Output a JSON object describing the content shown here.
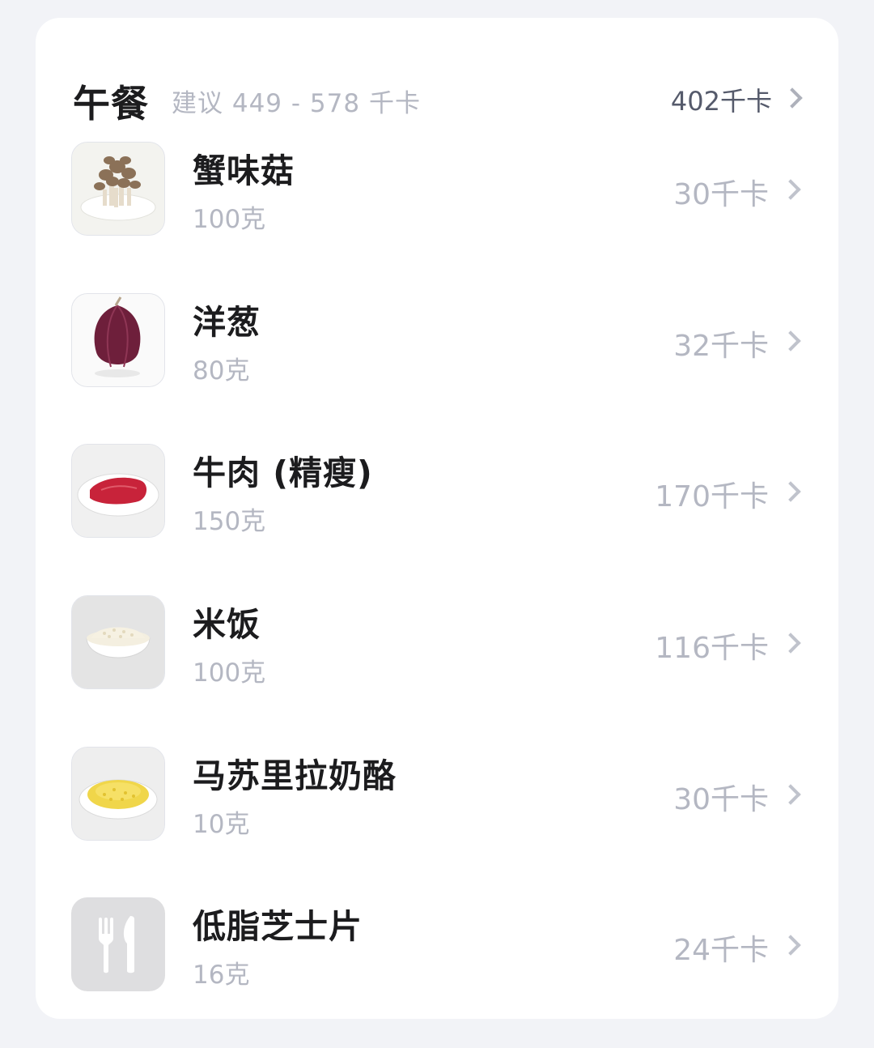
{
  "meal": {
    "title": "午餐",
    "suggestion": "建议 449 - 578 千卡",
    "total": "402千卡"
  },
  "items": [
    {
      "name": "蟹味菇",
      "amount": "100克",
      "kcal": "30千卡",
      "icon": "mushroom-photo"
    },
    {
      "name": "洋葱",
      "amount": "80克",
      "kcal": "32千卡",
      "icon": "onion-photo"
    },
    {
      "name": "牛肉 (精瘦)",
      "amount": "150克",
      "kcal": "170千卡",
      "icon": "beef-photo"
    },
    {
      "name": "米饭",
      "amount": "100克",
      "kcal": "116千卡",
      "icon": "rice-photo"
    },
    {
      "name": "马苏里拉奶酪",
      "amount": "10克",
      "kcal": "30千卡",
      "icon": "cheese-photo"
    },
    {
      "name": "低脂芝士片",
      "amount": "16克",
      "kcal": "24千卡",
      "icon": "fork-knife-icon"
    }
  ]
}
